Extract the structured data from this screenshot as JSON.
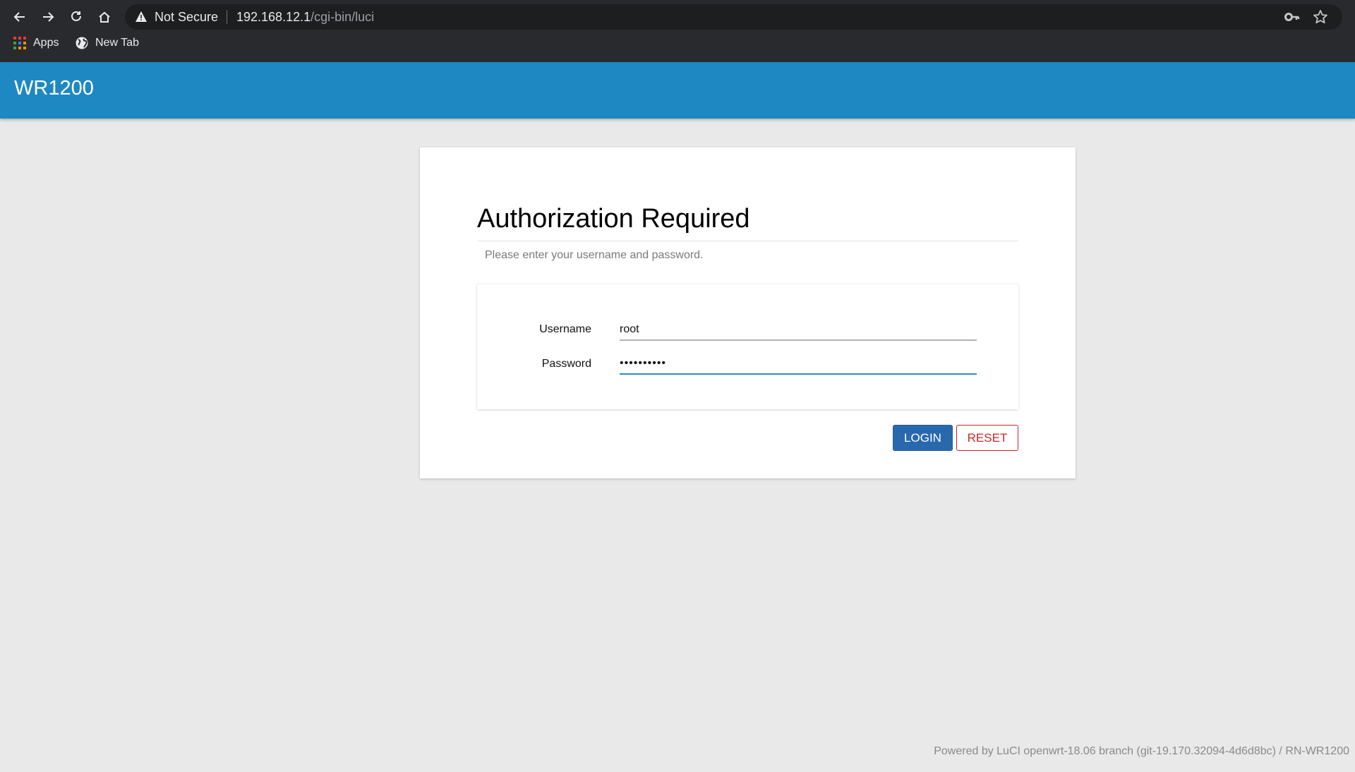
{
  "browser": {
    "nav": {
      "back_icon": "arrow-left-icon",
      "forward_icon": "arrow-right-icon",
      "reload_icon": "reload-icon",
      "home_icon": "home-icon"
    },
    "omnibox": {
      "security_icon": "warning-triangle-icon",
      "security_label": "Not Secure",
      "url_host": "192.168.12.1",
      "url_path": "/cgi-bin/luci",
      "key_icon": "key-icon",
      "star_icon": "star-icon"
    },
    "bookmarks": [
      {
        "label": "Apps",
        "icon": "apps-grid-icon"
      },
      {
        "label": "New Tab",
        "icon": "globe-icon"
      }
    ]
  },
  "header": {
    "brand": "WR1200",
    "color": "#1e88c3"
  },
  "login": {
    "title": "Authorization Required",
    "subtitle": "Please enter your username and password.",
    "fields": {
      "username": {
        "label": "Username",
        "value": "root"
      },
      "password": {
        "label": "Password",
        "value": "••••••••••"
      }
    },
    "buttons": {
      "login": "LOGIN",
      "reset": "RESET"
    },
    "colors": {
      "login_bg": "#2a68ad",
      "reset_border": "#c62828",
      "focus_underline": "#2c8ad0"
    }
  },
  "footer": {
    "text": "Powered by LuCI openwrt-18.06 branch (git-19.170.32094-4d6d8bc) / RN-WR1200"
  }
}
